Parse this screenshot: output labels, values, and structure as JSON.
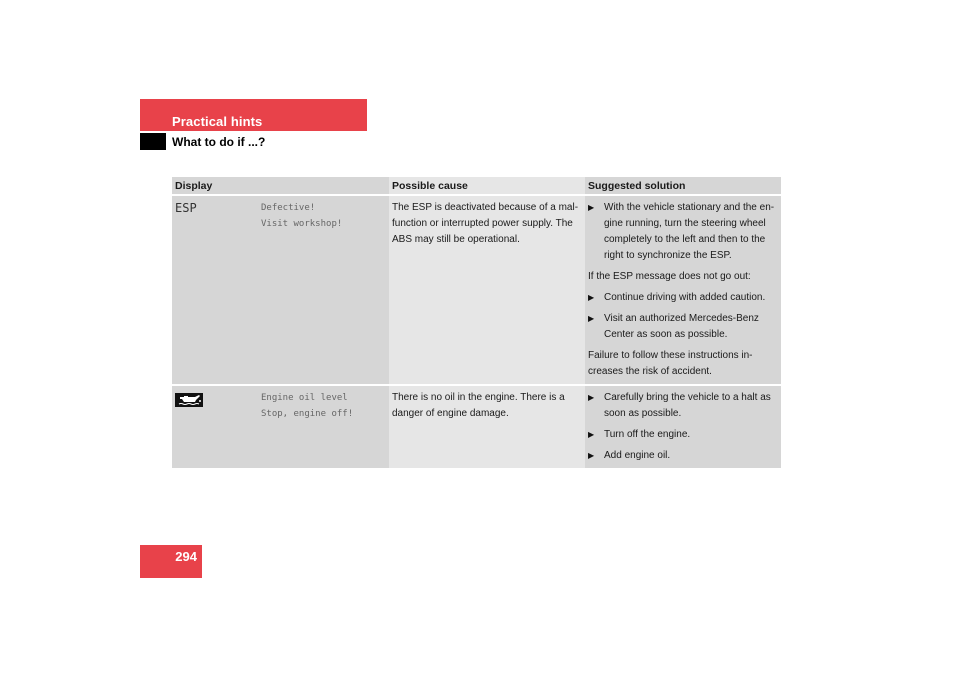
{
  "header": {
    "section_title": "Practical hints",
    "subsection_title": "What to do if ...?"
  },
  "table": {
    "columns": [
      "Display",
      "Possible cause",
      "Suggested solution"
    ],
    "rows": [
      {
        "display_code": "ESP",
        "display_icon": null,
        "display_message": [
          "Defective!",
          "Visit workshop!"
        ],
        "cause": "The ESP is deactivated because of a mal-function or interrupted power supply. The ABS may still be operational.",
        "solution": [
          {
            "type": "bullet",
            "text": "With the vehicle stationary and the en-gine running, turn the steering wheel completely to the left and then to the right to synchronize the ESP."
          },
          {
            "type": "text",
            "text": "If the ESP message does not go out:"
          },
          {
            "type": "bullet",
            "text": "Continue driving with added caution."
          },
          {
            "type": "bullet",
            "text": "Visit an authorized Mercedes-Benz Center as soon as possible."
          },
          {
            "type": "text",
            "text": "Failure to follow these instructions in-creases the risk of accident."
          }
        ]
      },
      {
        "display_code": "",
        "display_icon": "engine-oil-icon",
        "display_message": [
          "Engine oil level",
          "Stop, engine off!"
        ],
        "cause": "There is no oil in the engine. There is a danger of engine damage.",
        "solution": [
          {
            "type": "bullet",
            "text": "Carefully bring the vehicle to a halt as soon as possible."
          },
          {
            "type": "bullet",
            "text": "Turn off the engine."
          },
          {
            "type": "bullet",
            "text": "Add engine oil."
          }
        ]
      }
    ]
  },
  "footer": {
    "page_number": "294"
  },
  "colors": {
    "accent_red": "#e8424a",
    "cell_dark": "#d6d6d6",
    "cell_light": "#e6e6e6"
  }
}
